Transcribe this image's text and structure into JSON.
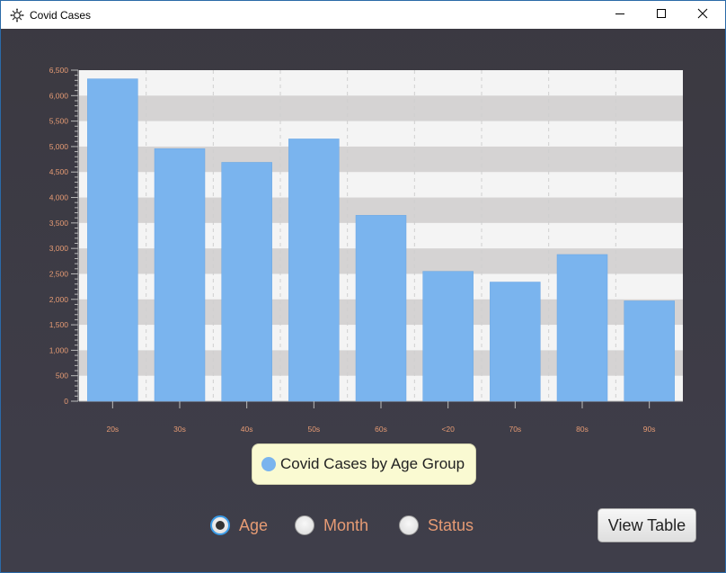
{
  "window": {
    "title": "Covid Cases",
    "controls": {
      "minimize_icon": "minimize-icon",
      "maximize_icon": "maximize-icon",
      "close_icon": "close-icon"
    }
  },
  "chart_data": {
    "type": "bar",
    "categories": [
      "20s",
      "30s",
      "40s",
      "50s",
      "60s",
      "<20",
      "70s",
      "80s",
      "90s"
    ],
    "series": [
      {
        "name": "Covid Cases by Age Group",
        "values": [
          6330,
          4960,
          4690,
          5150,
          3650,
          2550,
          2340,
          2880,
          1970
        ]
      }
    ],
    "ylim": [
      0,
      6500
    ],
    "y_ticks": [
      "0",
      "500",
      "1,000",
      "1,500",
      "2,000",
      "2,500",
      "3,000",
      "3,500",
      "4,000",
      "4,500",
      "5,000",
      "5,500",
      "6,000",
      "6,500"
    ],
    "grid": true,
    "legend_position": "bottom",
    "colors": {
      "bar": "#7ab4ee",
      "tick_label": "#e69b74",
      "band_light": "#f4f4f4",
      "band_dark": "#d5d3d3"
    }
  },
  "legend": {
    "label": "Covid Cases by Age Group"
  },
  "controls": {
    "radios": [
      {
        "label": "Age",
        "selected": true
      },
      {
        "label": "Month",
        "selected": false
      },
      {
        "label": "Status",
        "selected": false
      }
    ],
    "view_table_label": "View Table"
  }
}
